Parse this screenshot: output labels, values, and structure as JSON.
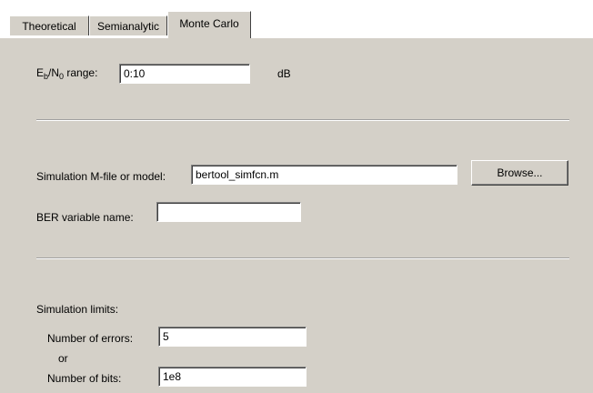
{
  "tabs": {
    "theoretical": "Theoretical",
    "semianalytic": "Semianalytic",
    "monte_carlo": "Monte Carlo",
    "active": "Monte Carlo"
  },
  "ebno": {
    "label_E": "E",
    "label_b": "b",
    "label_slash": "/N",
    "label_0": "0",
    "label_rest": " range:",
    "value": "0:10",
    "unit": "dB"
  },
  "simulation": {
    "mfile_label": "Simulation M-file or model:",
    "mfile_value": "bertool_simfcn.m",
    "browse_label": "Browse...",
    "ber_label": "BER variable name:",
    "ber_value": ""
  },
  "limits": {
    "heading": "Simulation limits:",
    "errors_label": "Number of errors:",
    "errors_value": "5",
    "or_label": "or",
    "bits_label": "Number of bits:",
    "bits_value": "1e8"
  },
  "colors": {
    "panel_bg": "#d4d0c8",
    "field_bg": "#ffffff"
  }
}
